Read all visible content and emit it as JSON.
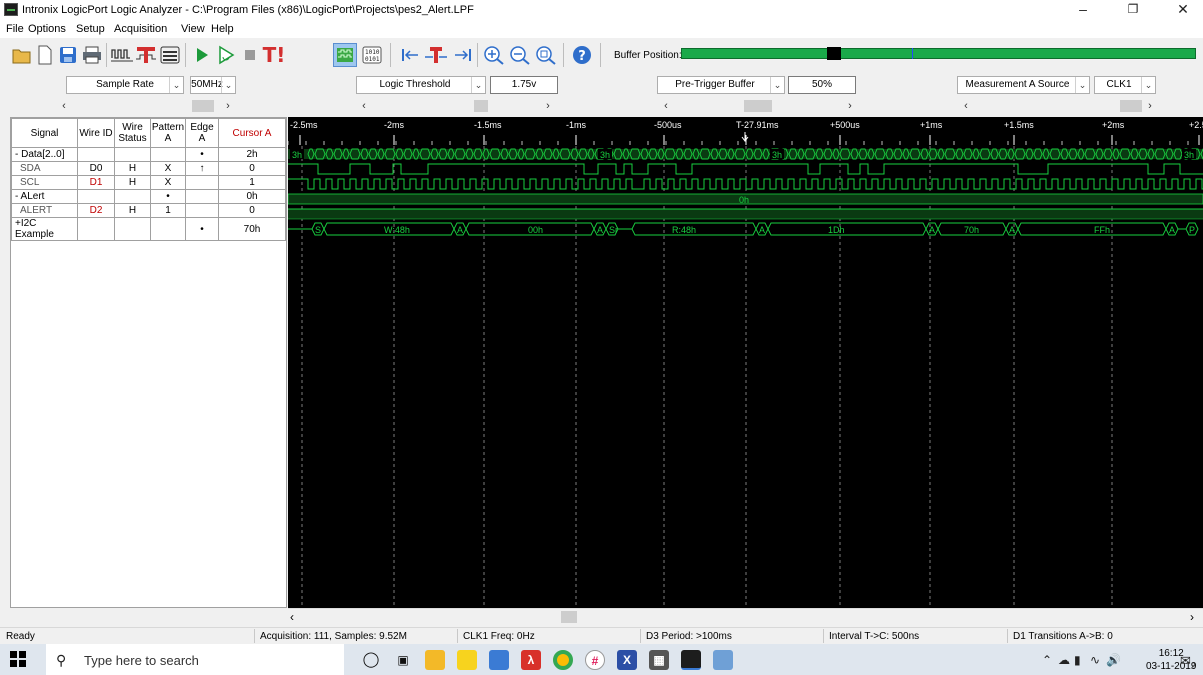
{
  "window": {
    "title": "Intronix LogicPort Logic Analyzer - C:\\Program Files (x86)\\LogicPort\\Projects\\pes2_Alert.LPF",
    "minimize": "–",
    "maximize": "❐",
    "close": "✕"
  },
  "menu": [
    "File",
    "Options",
    "Setup",
    "Acquisition",
    "View",
    "Help"
  ],
  "toolbar": {
    "buffer_label": "Buffer Position:",
    "trigger_icon_text": "T!"
  },
  "settings": {
    "sample_rate": {
      "label": "Sample Rate",
      "value": "50MHz"
    },
    "logic_threshold": {
      "label": "Logic Threshold",
      "value": "1.75v"
    },
    "pre_trigger": {
      "label": "Pre-Trigger Buffer",
      "value": "50%"
    },
    "measurement_a": {
      "label": "Measurement A Source",
      "value": "CLK1"
    }
  },
  "table": {
    "headers": [
      "Signal",
      "Wire ID",
      "Wire Status",
      "Pattern A",
      "Edge A",
      "Cursor A"
    ],
    "rows": [
      {
        "signal": "- Data[2..0]",
        "wire_id": "",
        "status": "",
        "pattern": "",
        "edge": "•",
        "cursor": "2h",
        "kind": "group"
      },
      {
        "signal": "SDA",
        "wire_id": "D0",
        "status": "H",
        "pattern": "X",
        "edge": "↑",
        "cursor": "0",
        "kind": "sub"
      },
      {
        "signal": "SCL",
        "wire_id": "D1",
        "status": "H",
        "pattern": "X",
        "edge": "",
        "cursor": "1",
        "kind": "sub"
      },
      {
        "signal": "- ALert",
        "wire_id": "",
        "status": "",
        "pattern": "•",
        "edge": "",
        "cursor": "0h",
        "kind": "group"
      },
      {
        "signal": "ALERT",
        "wire_id": "D2",
        "status": "H",
        "pattern": "1",
        "edge": "",
        "cursor": "0",
        "kind": "sub"
      },
      {
        "signal": "+I2C Example",
        "wire_id": "",
        "status": "",
        "pattern": "",
        "edge": "•",
        "cursor": "70h",
        "kind": "group"
      }
    ]
  },
  "timeline": {
    "ticks": [
      "-2.5ms",
      "-2ms",
      "-1.5ms",
      "-1ms",
      "-500us",
      "T-27.91ms",
      "+500us",
      "+1ms",
      "+1.5ms",
      "+2ms",
      "+2.5ms"
    ]
  },
  "waveform": {
    "data_bus_labels": [
      "3h",
      "3h",
      "3h",
      "3h"
    ],
    "alert_bus_label": "0h",
    "i2c_labels": [
      "S",
      "W:48h",
      "A",
      "00h",
      "A",
      "Sr",
      "R:48h",
      "A",
      "1Dh",
      "A",
      "70h",
      "A",
      "FFh",
      "A",
      "P"
    ]
  },
  "status": {
    "ready": "Ready",
    "acquisition": "Acquisition: 111, Samples: 9.52M",
    "clk": "CLK1 Freq: 0Hz",
    "period": "D3 Period: >100ms",
    "interval": "Interval T->C: 500ns",
    "transitions": "D1 Transitions A->B: 0"
  },
  "taskbar": {
    "search_placeholder": "Type here to search",
    "time": "16:12",
    "date": "03-11-2019",
    "notif_count": "2"
  }
}
